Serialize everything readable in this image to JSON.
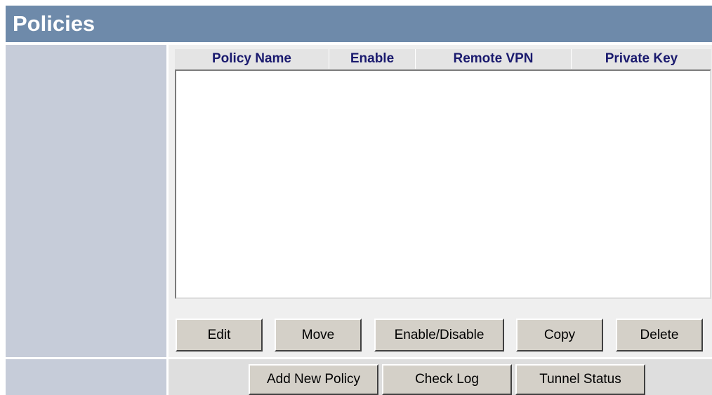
{
  "header": {
    "title": "Policies"
  },
  "policy_list": {
    "columns": [
      "Policy Name",
      "Enable",
      "Remote VPN",
      "Private Key"
    ],
    "rows": []
  },
  "actions": {
    "edit": "Edit",
    "move": "Move",
    "enable_disable": "Enable/Disable",
    "copy": "Copy",
    "delete": "Delete"
  },
  "footer_actions": {
    "add_new_policy": "Add New Policy",
    "check_log": "Check Log",
    "tunnel_status": "Tunnel Status"
  }
}
